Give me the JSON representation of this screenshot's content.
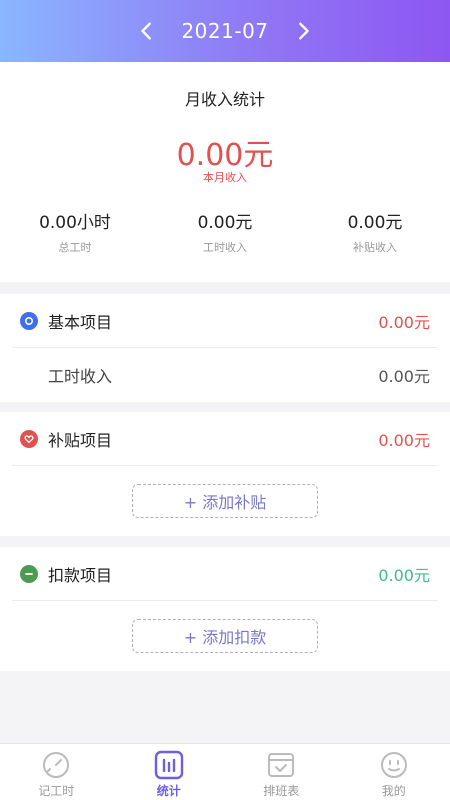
{
  "header": {
    "month": "2021-07"
  },
  "summary": {
    "title": "月收入统计",
    "total": "0.00元",
    "total_label": "本月收入",
    "stats": [
      {
        "value": "0.00小时",
        "label": "总工时"
      },
      {
        "value": "0.00元",
        "label": "工时收入"
      },
      {
        "value": "0.00元",
        "label": "补贴收入"
      }
    ]
  },
  "basic": {
    "title": "基本项目",
    "amount": "0.00元",
    "sub_label": "工时收入",
    "sub_amount": "0.00元"
  },
  "allowance": {
    "title": "补贴项目",
    "amount": "0.00元",
    "add_label": "+ 添加补贴"
  },
  "deduction": {
    "title": "扣款项目",
    "amount": "0.00元",
    "add_label": "+ 添加扣款"
  },
  "tabs": [
    {
      "label": "记工时",
      "icon": "clock-icon",
      "active": false
    },
    {
      "label": "统计",
      "icon": "bar-chart-icon",
      "active": true
    },
    {
      "label": "排班表",
      "icon": "calendar-check-icon",
      "active": false
    },
    {
      "label": "我的",
      "icon": "face-icon",
      "active": false
    }
  ],
  "colors": {
    "accent": "#6c5fe0",
    "income_red": "#e0524f",
    "deduction_green": "#3dbb8e",
    "basic_blue": "#3e6ff0"
  }
}
